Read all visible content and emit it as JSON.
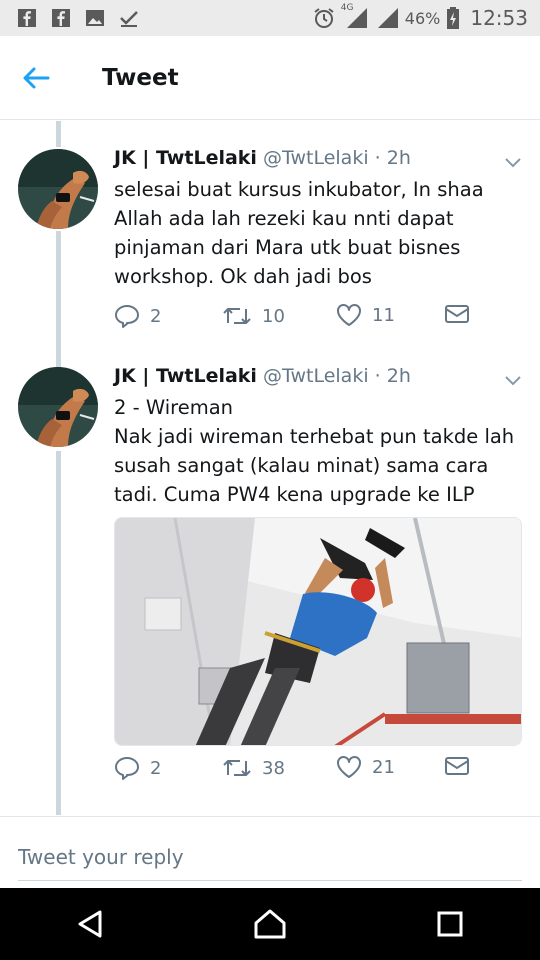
{
  "status_bar": {
    "left_icons": [
      "facebook-icon",
      "facebook-icon",
      "gallery-icon",
      "check-icon"
    ],
    "network": "4G",
    "battery": "46%",
    "time": "12:53"
  },
  "header": {
    "title": "Tweet",
    "back_icon": "arrow-left-icon"
  },
  "tweets": [
    {
      "name": "JK | TwtLelaki",
      "handle": "@TwtLelaki",
      "time": "· 2h",
      "lines": [
        "selesai buat kursus inkubator, In shaa",
        "Allah ada lah rezeki kau nnti dapat",
        "pinjaman dari Mara utk buat bisnes",
        "workshop. Ok dah jadi bos"
      ],
      "replies": "2",
      "retweets": "10",
      "likes": "11"
    },
    {
      "name": "JK | TwtLelaki",
      "handle": "@TwtLelaki",
      "time": "· 2h",
      "lines": [
        "2 - Wireman",
        "Nak jadi wireman terhebat pun takde lah",
        "susah sangat (kalau minat) sama cara",
        "tadi. Cuma PW4 kena upgrade ke ILP"
      ],
      "replies": "2",
      "retweets": "38",
      "likes": "21"
    }
  ],
  "reply": {
    "placeholder": "Tweet your reply"
  },
  "colors": {
    "accent": "#1da1f2",
    "text": "#14171a",
    "muted": "#657786",
    "border": "#e1e8ed"
  }
}
